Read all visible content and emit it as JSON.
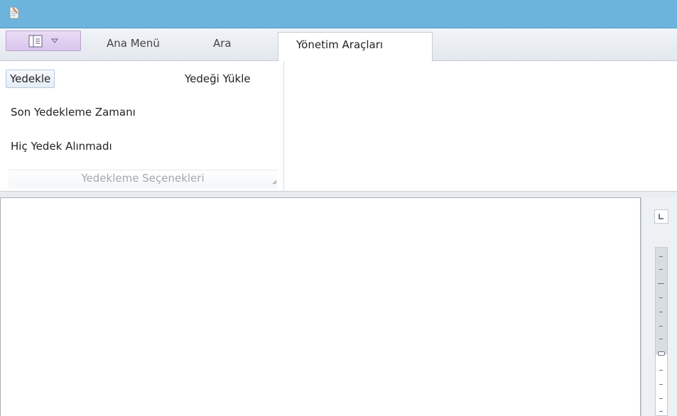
{
  "window": {
    "app_icon": "document-icon"
  },
  "tabs": {
    "app_menu_icon": "layout-panel-icon",
    "items": [
      {
        "label": "Ana Menü"
      },
      {
        "label": "Ara"
      },
      {
        "label": "Yönetim Araçları"
      }
    ],
    "active_index": 2
  },
  "ribbon": {
    "group": {
      "commands": {
        "backup": "Yedekle",
        "restore": "Yedeği Yükle",
        "last_backup_label": "Son Yedekleme Zamanı",
        "last_backup_value": "Hiç Yedek Alınmadı"
      },
      "label": "Yedekleme Seçenekleri"
    }
  },
  "editor": {
    "tab_selector_icon": "left-tab-icon"
  },
  "colors": {
    "titlebar": "#6cb4dc",
    "app_menu": "#d9c5ec"
  }
}
